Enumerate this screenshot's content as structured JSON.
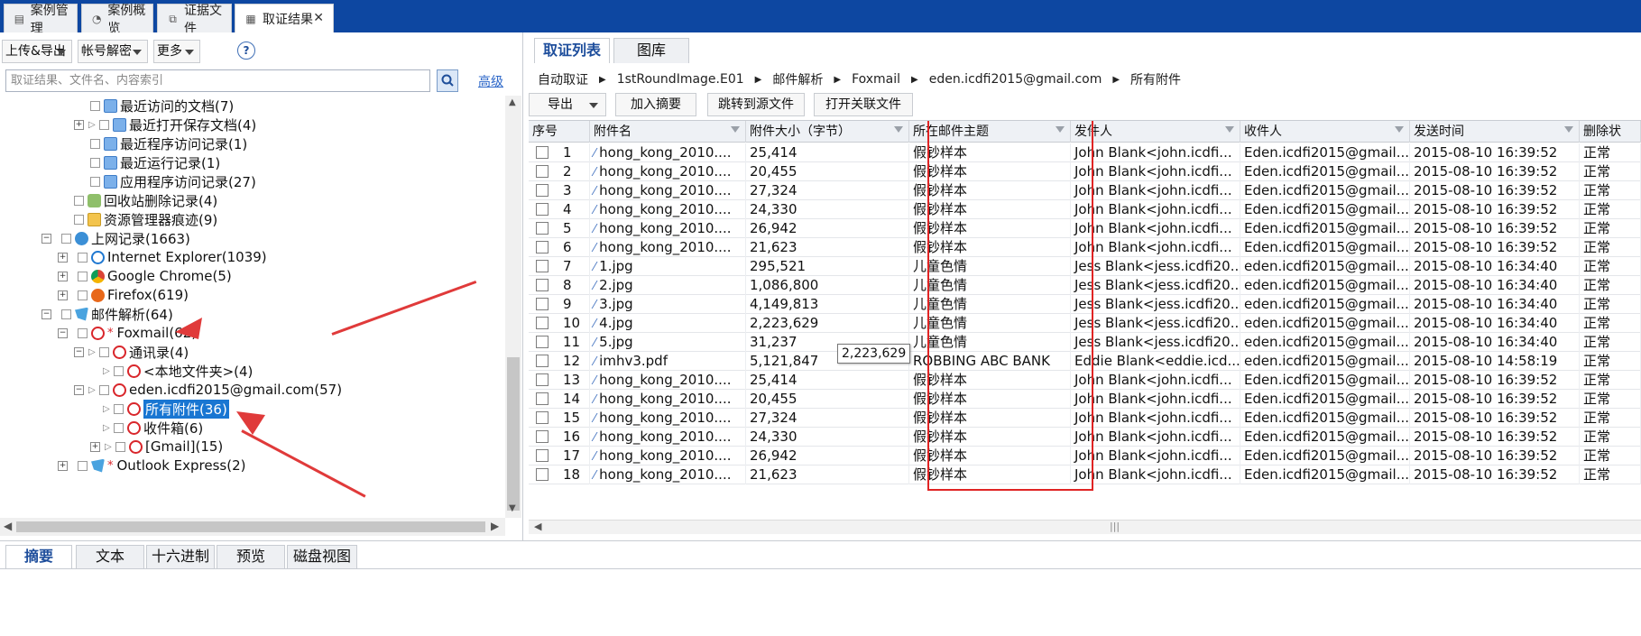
{
  "top_tabs": [
    {
      "label": "案例管理",
      "icon": "case-management-icon"
    },
    {
      "label": "案例概览",
      "icon": "overview-icon"
    },
    {
      "label": "证据文件",
      "icon": "evidence-file-icon"
    },
    {
      "label": "取证结果",
      "icon": "results-icon",
      "active": true,
      "close": "✕"
    }
  ],
  "left": {
    "toolbar": {
      "upload_export": "上传&导出",
      "account_decrypt": "帐号解密",
      "more": "更多",
      "help": "?"
    },
    "search_placeholder": "取证结果、文件名、内容索引",
    "advanced": "高级",
    "tree": [
      "最近访问的文档(7)",
      "最近打开保存文档(4)",
      "最近程序访问记录(1)",
      "最近运行记录(1)",
      "应用程序访问记录(27)",
      "回收站删除记录(4)",
      "资源管理器痕迹(9)",
      "上网记录(1663)",
      "Internet Explorer(1039)",
      "Google Chrome(5)",
      "Firefox(619)",
      "邮件解析(64)",
      "Foxmail(62)",
      "通讯录(4)",
      "<本地文件夹>(4)",
      "eden.icdfi2015@gmail.com(57)",
      "所有附件(36)",
      "收件箱(6)",
      "[Gmail](15)",
      "Outlook Express(2)"
    ],
    "star": "*"
  },
  "right": {
    "tabs": [
      "取证列表",
      "图库"
    ],
    "breadcrumb": [
      "自动取证",
      "1stRoundImage.E01",
      "邮件解析",
      "Foxmail",
      "eden.icdfi2015@gmail.com",
      "所有附件"
    ],
    "toolbar": {
      "export": "导出",
      "add_summary": "加入摘要",
      "jump_source": "跳转到源文件",
      "open_related": "打开关联文件"
    },
    "columns": [
      "序号",
      "附件名",
      "附件大小（字节）",
      "所在邮件主题",
      "发件人",
      "收件人",
      "发送时间",
      "删除状"
    ],
    "rows": [
      [
        "1",
        "hong_kong_2010....",
        "25,414",
        "假钞样本",
        "John Blank<john.icdfi...",
        "Eden.icdfi2015@gmail...",
        "2015-08-10 16:39:52",
        "正常"
      ],
      [
        "2",
        "hong_kong_2010....",
        "20,455",
        "假钞样本",
        "John Blank<john.icdfi...",
        "Eden.icdfi2015@gmail...",
        "2015-08-10 16:39:52",
        "正常"
      ],
      [
        "3",
        "hong_kong_2010....",
        "27,324",
        "假钞样本",
        "John Blank<john.icdfi...",
        "Eden.icdfi2015@gmail...",
        "2015-08-10 16:39:52",
        "正常"
      ],
      [
        "4",
        "hong_kong_2010....",
        "24,330",
        "假钞样本",
        "John Blank<john.icdfi...",
        "Eden.icdfi2015@gmail...",
        "2015-08-10 16:39:52",
        "正常"
      ],
      [
        "5",
        "hong_kong_2010....",
        "26,942",
        "假钞样本",
        "John Blank<john.icdfi...",
        "Eden.icdfi2015@gmail...",
        "2015-08-10 16:39:52",
        "正常"
      ],
      [
        "6",
        "hong_kong_2010....",
        "21,623",
        "假钞样本",
        "John Blank<john.icdfi...",
        "Eden.icdfi2015@gmail...",
        "2015-08-10 16:39:52",
        "正常"
      ],
      [
        "7",
        "1.jpg",
        "295,521",
        "儿童色情",
        "Jess Blank<jess.icdfi20...",
        "eden.icdfi2015@gmail....",
        "2015-08-10 16:34:40",
        "正常"
      ],
      [
        "8",
        "2.jpg",
        "1,086,800",
        "儿童色情",
        "Jess Blank<jess.icdfi20...",
        "eden.icdfi2015@gmail....",
        "2015-08-10 16:34:40",
        "正常"
      ],
      [
        "9",
        "3.jpg",
        "4,149,813",
        "儿童色情",
        "Jess Blank<jess.icdfi20...",
        "eden.icdfi2015@gmail....",
        "2015-08-10 16:34:40",
        "正常"
      ],
      [
        "10",
        "4.jpg",
        "2,223,629",
        "儿童色情",
        "Jess Blank<jess.icdfi20...",
        "eden.icdfi2015@gmail....",
        "2015-08-10 16:34:40",
        "正常"
      ],
      [
        "11",
        "5.jpg",
        "31,237",
        "儿童色情",
        "Jess Blank<jess.icdfi20...",
        "eden.icdfi2015@gmail....",
        "2015-08-10 16:34:40",
        "正常"
      ],
      [
        "12",
        "imhv3.pdf",
        "5,121,847",
        "ROBBING ABC BANK",
        "Eddie Blank<eddie.icd...",
        "eden.icdfi2015@gmail....",
        "2015-08-10 14:58:19",
        "正常"
      ],
      [
        "13",
        "hong_kong_2010....",
        "25,414",
        "假钞样本",
        "John Blank<john.icdfi...",
        "Eden.icdfi2015@gmail...",
        "2015-08-10 16:39:52",
        "正常"
      ],
      [
        "14",
        "hong_kong_2010....",
        "20,455",
        "假钞样本",
        "John Blank<john.icdfi...",
        "Eden.icdfi2015@gmail...",
        "2015-08-10 16:39:52",
        "正常"
      ],
      [
        "15",
        "hong_kong_2010....",
        "27,324",
        "假钞样本",
        "John Blank<john.icdfi...",
        "Eden.icdfi2015@gmail...",
        "2015-08-10 16:39:52",
        "正常"
      ],
      [
        "16",
        "hong_kong_2010....",
        "24,330",
        "假钞样本",
        "John Blank<john.icdfi...",
        "Eden.icdfi2015@gmail...",
        "2015-08-10 16:39:52",
        "正常"
      ],
      [
        "17",
        "hong_kong_2010....",
        "26,942",
        "假钞样本",
        "John Blank<john.icdfi...",
        "Eden.icdfi2015@gmail...",
        "2015-08-10 16:39:52",
        "正常"
      ],
      [
        "18",
        "hong_kong_2010....",
        "21,623",
        "假钞样本",
        "John Blank<john.icdfi...",
        "Eden.icdfi2015@gmail...",
        "2015-08-10 16:39:52",
        "正常"
      ]
    ],
    "tooltip": "2,223,629",
    "highlight_color": "#e02424"
  },
  "bottom_tabs": [
    "摘要",
    "文本",
    "十六进制",
    "预览",
    "磁盘视图"
  ],
  "colors": {
    "titlebar": "#0d47a1",
    "selection": "#1976d2",
    "annotation_arrow": "#e03a3a"
  }
}
